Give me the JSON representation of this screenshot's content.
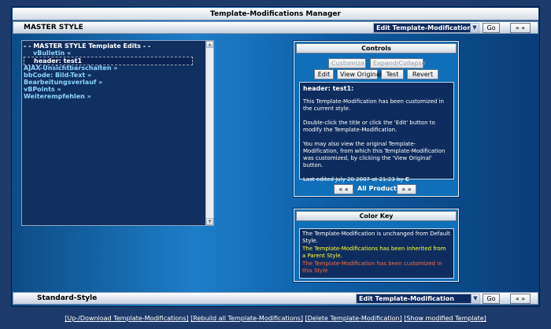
{
  "title": "Template-Modifications Manager",
  "top_bar": {
    "style_name": "MASTER STYLE",
    "select_value": "Edit Template-Modification",
    "go_label": "Go",
    "nav_label": "» «"
  },
  "tree": {
    "root": "- - MASTER STYLE Template Edits - -",
    "items": [
      {
        "label": "vBulletin «",
        "level": 1
      },
      {
        "label": "header: test1",
        "level": 2,
        "selected": true
      },
      {
        "label": "AJAX-Unsichtbarschalten »",
        "level": 0
      },
      {
        "label": "bbCode: Bild-Text »",
        "level": 0
      },
      {
        "label": "Bearbeitungsverlauf »",
        "level": 0
      },
      {
        "label": "vBPoints »",
        "level": 0
      },
      {
        "label": "Weiterempfehlen »",
        "level": 0
      }
    ]
  },
  "controls": {
    "heading": "Controls",
    "customize": "Customize",
    "expand": "Expand/Collapse",
    "edit": "Edit",
    "view_original": "View Original",
    "test": "Test",
    "revert": "Revert",
    "info_title": "header: test1:",
    "info_p1": "This Template-Modification has been customized in the current style.",
    "info_p2": "Double-click the title or click the 'Edit' button to modify the Template-Modification.",
    "info_p3": "You may also view the original Template-Modification, from which this Template-Modification was customized, by clicking the 'View Original' button.",
    "info_last": "Last edited July 20 2007 at 21:23 by ",
    "info_user": "C",
    "prev": "« «",
    "products": "All Products",
    "next": "» »"
  },
  "color_key": {
    "heading": "Color Key",
    "unchanged": "The Template-Modification is unchanged from Default Style.",
    "inherited": "The Template-Modifications has been inherited from a Parent Style.",
    "customized": "The Template-Modification has been customized in this Style",
    "colors": {
      "unchanged": "#ffffff",
      "inherited": "#ffff33",
      "customized": "#ff6a3d"
    }
  },
  "bottom_bar": {
    "style_name": "Standard-Style",
    "select_value": "Edit Template-Modification",
    "go_label": "Go",
    "nav_label": "« »"
  },
  "footer": {
    "links": [
      "[Up-/Download Template-Modifications]",
      "[Rebuild all Template-Modifications]",
      "[Delete Template-Modification]",
      "[Show modified Template]"
    ]
  }
}
